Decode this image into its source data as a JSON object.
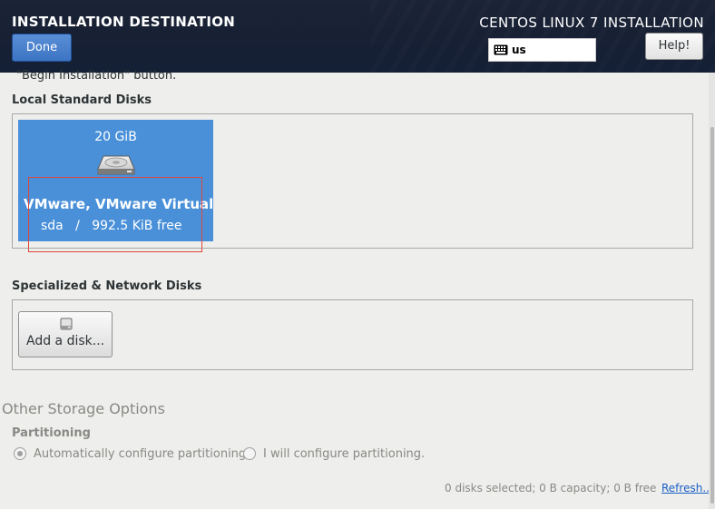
{
  "header": {
    "spoke_title": "INSTALLATION DESTINATION",
    "done_label": "Done",
    "product_title": "CENTOS LINUX 7 INSTALLATION",
    "keyboard_layout": "us",
    "help_label": "Help!"
  },
  "main": {
    "cutoff_text": "\"Begin Installation\" button.",
    "local_disks_label": "Local Standard Disks",
    "disks": [
      {
        "size": "20 GiB",
        "name": "VMware, VMware Virtual S",
        "device": "sda",
        "separator": "/",
        "free": "992.5 KiB free",
        "selected": true
      }
    ],
    "specialized_label": "Specialized & Network Disks",
    "add_disk_label": "Add a disk..."
  },
  "other_storage": {
    "heading": "Other Storage Options",
    "partitioning_label": "Partitioning",
    "options": [
      {
        "label": "Automatically configure partitioning.",
        "checked": true
      },
      {
        "label": "I will configure partitioning.",
        "checked": false
      }
    ]
  },
  "footer": {
    "summary": "0 disks selected; 0 B capacity; 0 B free",
    "refresh_label": "Refresh..."
  },
  "colors": {
    "header_bg": "#172034",
    "disk_selected": "#4a90d9",
    "done_button": "#3d74c4",
    "highlight": "#e0453c",
    "link": "#1a5ec7"
  }
}
